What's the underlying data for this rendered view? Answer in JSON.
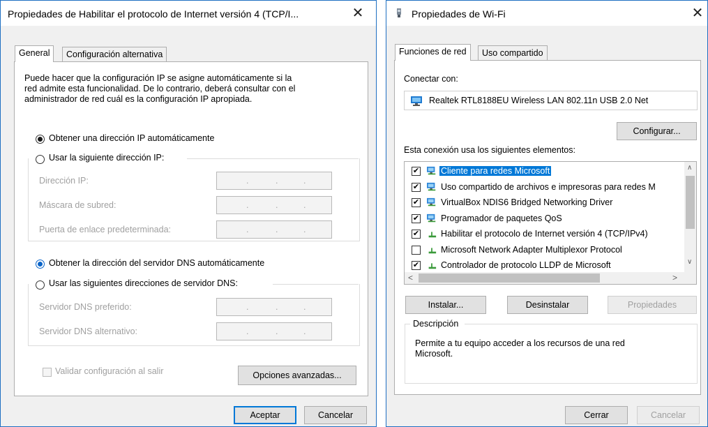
{
  "ipv4": {
    "title": "Propiedades de Habilitar el protocolo de Internet versión 4 (TCP/I...",
    "close": "✕",
    "tabs": [
      "General",
      "Configuración alternativa"
    ],
    "description": "Puede hacer que la configuración IP se asigne automáticamente si la\nred admite esta funcionalidad. De lo contrario, deberá consultar con el\nadministrador de red cuál es la configuración IP apropiada.",
    "radio_ip_auto": "Obtener una dirección IP automáticamente",
    "radio_ip_manual": "Usar la siguiente dirección IP:",
    "ip_label": "Dirección IP:",
    "mask_label": "Máscara de subred:",
    "gateway_label": "Puerta de enlace predeterminada:",
    "radio_dns_auto": "Obtener la dirección del servidor DNS automáticamente",
    "radio_dns_manual": "Usar las siguientes direcciones de servidor DNS:",
    "dns_pref_label": "Servidor DNS preferido:",
    "dns_alt_label": "Servidor DNS alternativo:",
    "ip_dot": ".",
    "validate_label": "Validar configuración al salir",
    "advanced_button": "Opciones avanzadas...",
    "ok_button": "Aceptar",
    "cancel_button": "Cancelar"
  },
  "wifi": {
    "title": "Propiedades de Wi-Fi",
    "close": "✕",
    "tabs": [
      "Funciones de red",
      "Uso compartido"
    ],
    "connect_with_label": "Conectar con:",
    "adapter_name": "Realtek RTL8188EU Wireless LAN 802.11n USB 2.0 Net",
    "configure_button": "Configurar...",
    "elements_label": "Esta conexión usa los siguientes elementos:",
    "items": [
      {
        "label": "Cliente para redes Microsoft",
        "checked": true,
        "icon": "network-client-icon"
      },
      {
        "label": "Uso compartido de archivos e impresoras para redes M",
        "checked": true,
        "icon": "file-sharing-icon"
      },
      {
        "label": "VirtualBox NDIS6 Bridged Networking Driver",
        "checked": true,
        "icon": "network-service-icon"
      },
      {
        "label": "Programador de paquetes QoS",
        "checked": true,
        "icon": "network-service-icon"
      },
      {
        "label": "Habilitar el protocolo de Internet versión 4 (TCP/IPv4)",
        "checked": true,
        "icon": "protocol-icon"
      },
      {
        "label": "Microsoft Network Adapter Multiplexor Protocol",
        "checked": false,
        "icon": "protocol-icon"
      },
      {
        "label": "Controlador de protocolo LLDP de Microsoft",
        "checked": true,
        "icon": "protocol-icon"
      }
    ],
    "install_button": "Instalar...",
    "uninstall_button": "Desinstalar",
    "properties_button": "Propiedades",
    "description_legend": "Descripción",
    "description_text": "Permite a tu equipo acceder a los recursos de una red\nMicrosoft.",
    "close_button": "Cerrar",
    "cancel_button": "Cancelar"
  },
  "colors": {
    "accent": "#0078d7",
    "selection": "#0078d7",
    "window_bg": "#f0f0f0"
  }
}
